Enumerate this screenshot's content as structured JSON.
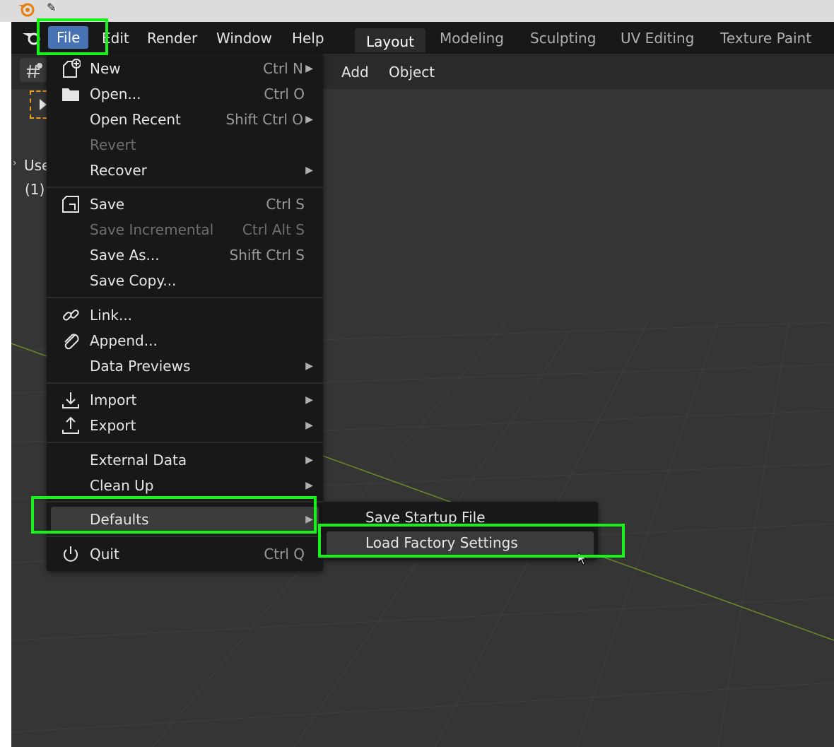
{
  "os_bar": {
    "pin_icon": "pin-icon",
    "logo_icon": "blender-logo-icon"
  },
  "menubar": {
    "items": [
      "File",
      "Edit",
      "Render",
      "Window",
      "Help"
    ],
    "active": "File"
  },
  "workspaces": {
    "tabs": [
      "Layout",
      "Modeling",
      "Sculpting",
      "UV Editing",
      "Texture Paint"
    ],
    "active": "Layout"
  },
  "viewport_header": {
    "add_label": "Add",
    "object_label": "Object"
  },
  "viewport_overlay": {
    "view_label": "Use",
    "collection_label": "(1)"
  },
  "file_menu": {
    "items": [
      {
        "label": "New",
        "shortcut": "Ctrl N",
        "submenu": true,
        "icon": "new-file-icon"
      },
      {
        "label": "Open...",
        "shortcut": "Ctrl O",
        "icon": "folder-icon"
      },
      {
        "label": "Open Recent",
        "shortcut": "Shift Ctrl O",
        "submenu": true
      },
      {
        "label": "Revert",
        "disabled": true
      },
      {
        "label": "Recover",
        "submenu": true
      },
      {
        "label": "Save",
        "shortcut": "Ctrl S",
        "icon": "save-icon"
      },
      {
        "label": "Save Incremental",
        "shortcut": "Ctrl Alt S",
        "disabled": true
      },
      {
        "label": "Save As...",
        "shortcut": "Shift Ctrl S"
      },
      {
        "label": "Save Copy..."
      },
      {
        "label": "Link...",
        "icon": "link-icon"
      },
      {
        "label": "Append...",
        "icon": "append-icon"
      },
      {
        "label": "Data Previews",
        "submenu": true
      },
      {
        "label": "Import",
        "submenu": true,
        "icon": "import-icon"
      },
      {
        "label": "Export",
        "submenu": true,
        "icon": "export-icon"
      },
      {
        "label": "External Data",
        "submenu": true
      },
      {
        "label": "Clean Up",
        "submenu": true
      },
      {
        "label": "Defaults",
        "submenu": true,
        "highlighted": true
      },
      {
        "label": "Quit",
        "shortcut": "Ctrl Q",
        "icon": "power-icon"
      }
    ]
  },
  "defaults_submenu": {
    "items": [
      {
        "label": "Save Startup File"
      },
      {
        "label": "Load Factory Settings",
        "highlighted": true
      }
    ]
  },
  "colors": {
    "accent": "#4772b3",
    "highlight_box": "#18f21a",
    "menu_bg": "#181818",
    "viewport_bg": "#353535"
  }
}
